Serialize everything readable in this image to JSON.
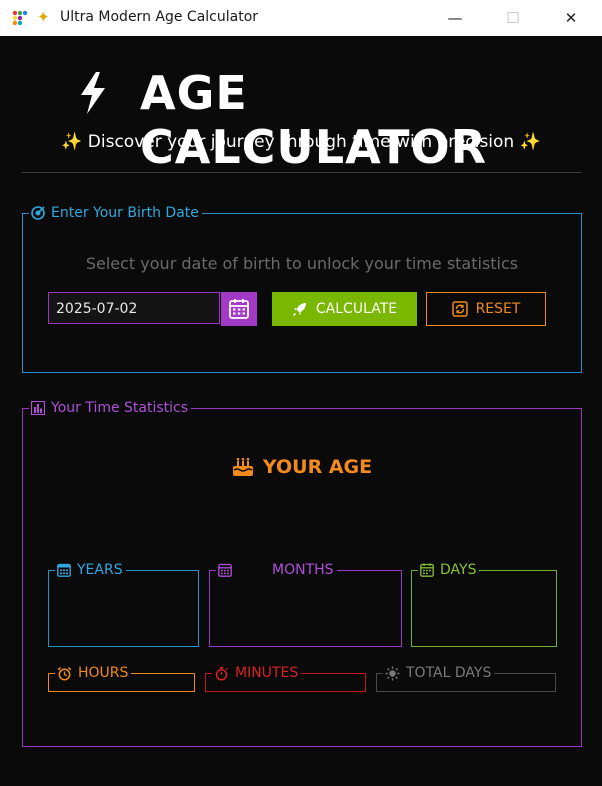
{
  "window": {
    "title": "Ultra Modern Age Calculator",
    "title_icon": "sparkles-icon",
    "minimize_symbol": "—",
    "maximize_symbol": "☐",
    "close_symbol": "✕"
  },
  "header": {
    "icon": "lightning-bolt-icon",
    "title": "AGE CALCULATOR",
    "subtitle": "Discover your journey through time with precision",
    "subtitle_icon": "sparkles-icon"
  },
  "birth_section": {
    "legend": "Enter Your Birth Date",
    "legend_icon": "target-icon",
    "prompt": "Select your date of birth to unlock your time statistics",
    "date_value": "2025-07-02",
    "calendar_icon": "calendar-icon",
    "calculate_label": "CALCULATE",
    "calculate_icon": "rocket-icon",
    "reset_label": "RESET",
    "reset_icon": "refresh-icon"
  },
  "stats_section": {
    "legend": "Your Time Statistics",
    "legend_icon": "bar-chart-icon",
    "age_heading": "YOUR AGE",
    "age_icon": "birthday-cake-icon",
    "years_label": "YEARS",
    "months_label": "MONTHS",
    "days_label": "DAYS",
    "hours_label": "HOURS",
    "minutes_label": "MINUTES",
    "total_days_label": "TOTAL DAYS"
  },
  "colors": {
    "background": "#0a0a0a",
    "blue": "#2b8fc7",
    "purple": "#9b36c6",
    "green": "#79b700",
    "orange": "#f08a1c",
    "red": "#c41818",
    "gray": "#4a4a4a"
  }
}
